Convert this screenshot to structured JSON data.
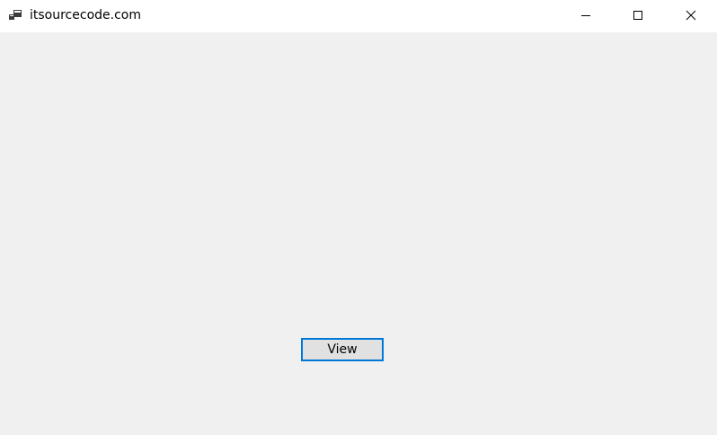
{
  "window": {
    "title": "itsourcecode.com",
    "app_icon": "app-window-icon",
    "caption_buttons": {
      "minimize_icon": "minimize-icon",
      "maximize_icon": "maximize-icon",
      "close_icon": "close-icon"
    }
  },
  "form": {
    "view_button_label": "View"
  },
  "colors": {
    "titlebar_bg": "#ffffff",
    "client_bg": "#f0f0f0",
    "button_bg": "#e1e1e1",
    "button_focus_border": "#0078d7"
  }
}
